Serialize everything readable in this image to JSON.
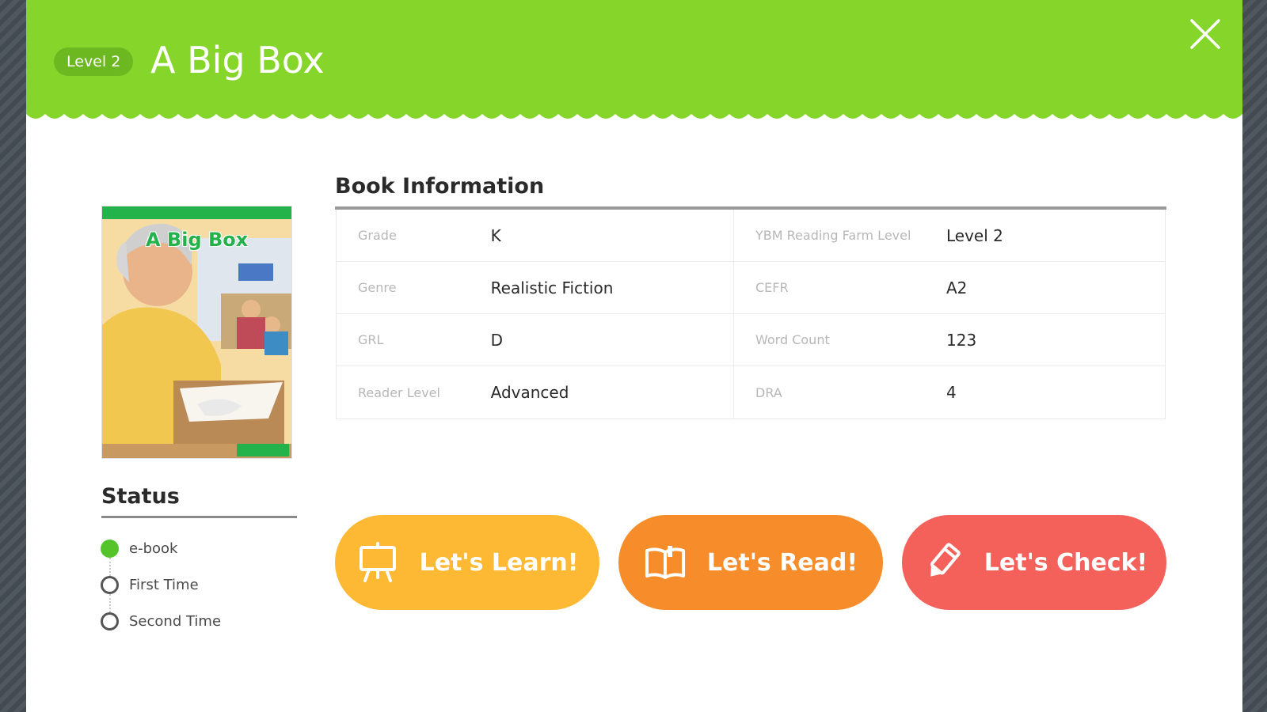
{
  "header": {
    "level_badge": "Level 2",
    "title": "A Big Box",
    "close_icon": "close-icon"
  },
  "cover": {
    "title": "A Big Box",
    "image": "book-cover-illustration"
  },
  "book_info": {
    "heading": "Book Information",
    "rows": [
      {
        "label_left": "Grade",
        "value_left": "K",
        "label_right": "YBM Reading Farm Level",
        "value_right": "Level 2"
      },
      {
        "label_left": "Genre",
        "value_left": "Realistic Fiction",
        "label_right": "CEFR",
        "value_right": "A2"
      },
      {
        "label_left": "GRL",
        "value_left": "D",
        "label_right": "Word Count",
        "value_right": "123"
      },
      {
        "label_left": "Reader Level",
        "value_left": "Advanced",
        "label_right": "DRA",
        "value_right": "4"
      }
    ]
  },
  "status": {
    "heading": "Status",
    "items": [
      {
        "label": "e-book",
        "done": true
      },
      {
        "label": "First Time",
        "done": false
      },
      {
        "label": "Second Time",
        "done": false
      }
    ]
  },
  "actions": {
    "learn": {
      "label": "Let's Learn!",
      "icon": "easel-icon",
      "color": "#fdb933"
    },
    "read": {
      "label": "Let's Read!",
      "icon": "open-book-icon",
      "color": "#f78d2a"
    },
    "check": {
      "label": "Let's Check!",
      "icon": "pencil-icon",
      "color": "#f4605a"
    }
  },
  "colors": {
    "header_green": "#86d52b",
    "badge_green": "#6cb820",
    "status_done": "#55c32a"
  }
}
